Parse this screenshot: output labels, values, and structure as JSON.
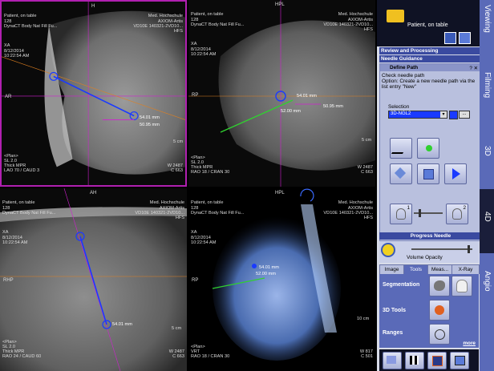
{
  "viewports": [
    {
      "tl": [
        "Patient, on table",
        "128",
        "DynaCT Body Nat Fill Fu...",
        "XA",
        "8/12/2014",
        "10:22:54 AM"
      ],
      "top_orient": "H",
      "tr": [
        "Med. Hochschule",
        "AXIOM-Artis",
        "VD10E 140321-2VD10...",
        "HFS"
      ],
      "left_orient": "AR",
      "bl": [
        "<Plan>",
        "SL 2.0",
        "Thick MPR",
        "LAO 70 / CAUD 3"
      ],
      "br": [
        "W  2487",
        "C    663"
      ],
      "measure": [
        "54.01 mm",
        "50.95 mm"
      ],
      "scale": "5 cm"
    },
    {
      "tl": [
        "Patient, on table",
        "128",
        "DynaCT Body Nat Fill Fu...",
        "XA",
        "8/12/2014",
        "10:22:54 AM"
      ],
      "top_orient": "HPL",
      "tr": [
        "Med. Hochschule",
        "AXIOM-Artis",
        "VD10E 140321-2VD10...",
        "HFS"
      ],
      "left_orient": "RP",
      "bl": [
        "<Plan>",
        "SL 2.0",
        "Thick MPR",
        "RAO 18 / CRAN 30"
      ],
      "br": [
        "W  2487",
        "C    663"
      ],
      "measure": [
        "54.01 mm",
        "50.95 mm",
        "52.00 mm"
      ],
      "scale": "5 cm"
    },
    {
      "tl": [
        "Patient, on table",
        "128",
        "DynaCT Body Nat Fill Fu...",
        "XA",
        "8/12/2014",
        "10:22:54 AM"
      ],
      "top_orient": "AH",
      "tr": [
        "Med. Hochschule",
        "AXIOM-Artis",
        "VD10E 140321-2VD10...",
        "HFS"
      ],
      "left_orient": "RHP",
      "bl": [
        "<Plan>",
        "SL 2.0",
        "Thick MPR",
        "RAO 24 / CAUD 60"
      ],
      "br": [
        "W  2487",
        "C    663"
      ],
      "measure": [
        "54.01 mm"
      ],
      "scale": "5 cm"
    },
    {
      "tl": [
        "Patient, on table",
        "128",
        "DynaCT Body Nat Fill Fu...",
        "XA",
        "8/12/2014",
        "10:22:54 AM"
      ],
      "top_orient": "HPL",
      "tr": [
        "Med. Hochschule",
        "AXIOM-Artis",
        "VD10E 140321-2VD10...",
        "HFS"
      ],
      "left_orient": "RP",
      "bl": [
        "<Plan>",
        "VRT",
        "RAO 18 / CRAN 30"
      ],
      "br": [
        "W  817",
        "C    501"
      ],
      "measure": [
        "54.01 mm",
        "52.00 mm"
      ],
      "scale": "10 cm"
    }
  ],
  "panel": {
    "patient_label": "Patient, on table",
    "review_processing": "Review and Processing",
    "needle_guidance": "Needle Guidance",
    "define_path": "Define Path",
    "help_close": "? ✕",
    "instructions_1": "Check needle path",
    "instructions_2": "Option: Create a new needle path via the list entry \"New\"",
    "selection_label": "Selection",
    "selection_value": "3D-NGL2",
    "more_btn": "...",
    "knob_1": "1",
    "knob_2": "2",
    "progress_needle": "Progress Needle",
    "volume_opacity": "Volume Opacity",
    "tabs": [
      "Image",
      "Tools",
      "Meas...",
      "X-Ray"
    ],
    "active_tab": "Tools",
    "segmentation": "Segmentation",
    "tools_3d": "3D Tools",
    "ranges": "Ranges",
    "more_link": "more",
    "vtabs": [
      "Viewing",
      "Filming",
      "3D",
      "4D",
      "Angio"
    ],
    "active_vtab": "4D"
  },
  "colors": {
    "active_border": "#b020b0",
    "needle": "#1a3aff",
    "orange": "#e08020",
    "magenta": "#d020d0",
    "green": "#30d030",
    "panel_accent": "#3a4aa0"
  }
}
